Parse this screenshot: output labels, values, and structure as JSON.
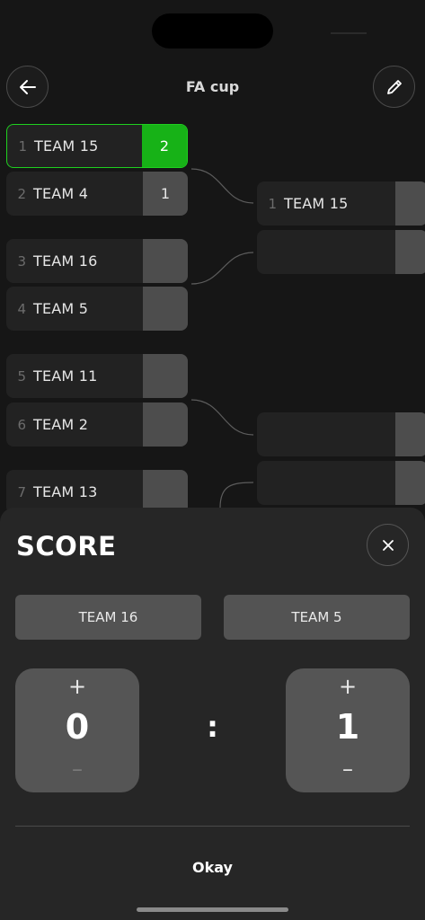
{
  "header": {
    "title": "FA cup",
    "back_icon": "arrow-left-icon",
    "edit_icon": "pencil-icon"
  },
  "bracket": {
    "round1": [
      {
        "seed": "1",
        "team": "TEAM 15",
        "score": "2",
        "winner": true
      },
      {
        "seed": "2",
        "team": "TEAM 4",
        "score": "1",
        "winner": false
      },
      {
        "seed": "3",
        "team": "TEAM 16",
        "score": "",
        "winner": false
      },
      {
        "seed": "4",
        "team": "TEAM 5",
        "score": "",
        "winner": false
      },
      {
        "seed": "5",
        "team": "TEAM 11",
        "score": "",
        "winner": false
      },
      {
        "seed": "6",
        "team": "TEAM 2",
        "score": "",
        "winner": false
      },
      {
        "seed": "7",
        "team": "TEAM 13",
        "score": "",
        "winner": false
      }
    ],
    "round2": [
      {
        "seed": "1",
        "team": "TEAM 15",
        "score": ""
      },
      {
        "seed": "",
        "team": "",
        "score": ""
      },
      {
        "seed": "",
        "team": "",
        "score": ""
      },
      {
        "seed": "",
        "team": "",
        "score": ""
      }
    ]
  },
  "score_sheet": {
    "title": "SCORE",
    "close_icon": "close-icon",
    "team_left": "TEAM 16",
    "team_right": "TEAM 5",
    "score_left": "0",
    "score_right": "1",
    "separator": ":",
    "plus": "+",
    "minus": "–",
    "confirm_label": "Okay"
  },
  "colors": {
    "winner_green": "#17b217",
    "background": "#161616",
    "sheet": "#262626"
  }
}
